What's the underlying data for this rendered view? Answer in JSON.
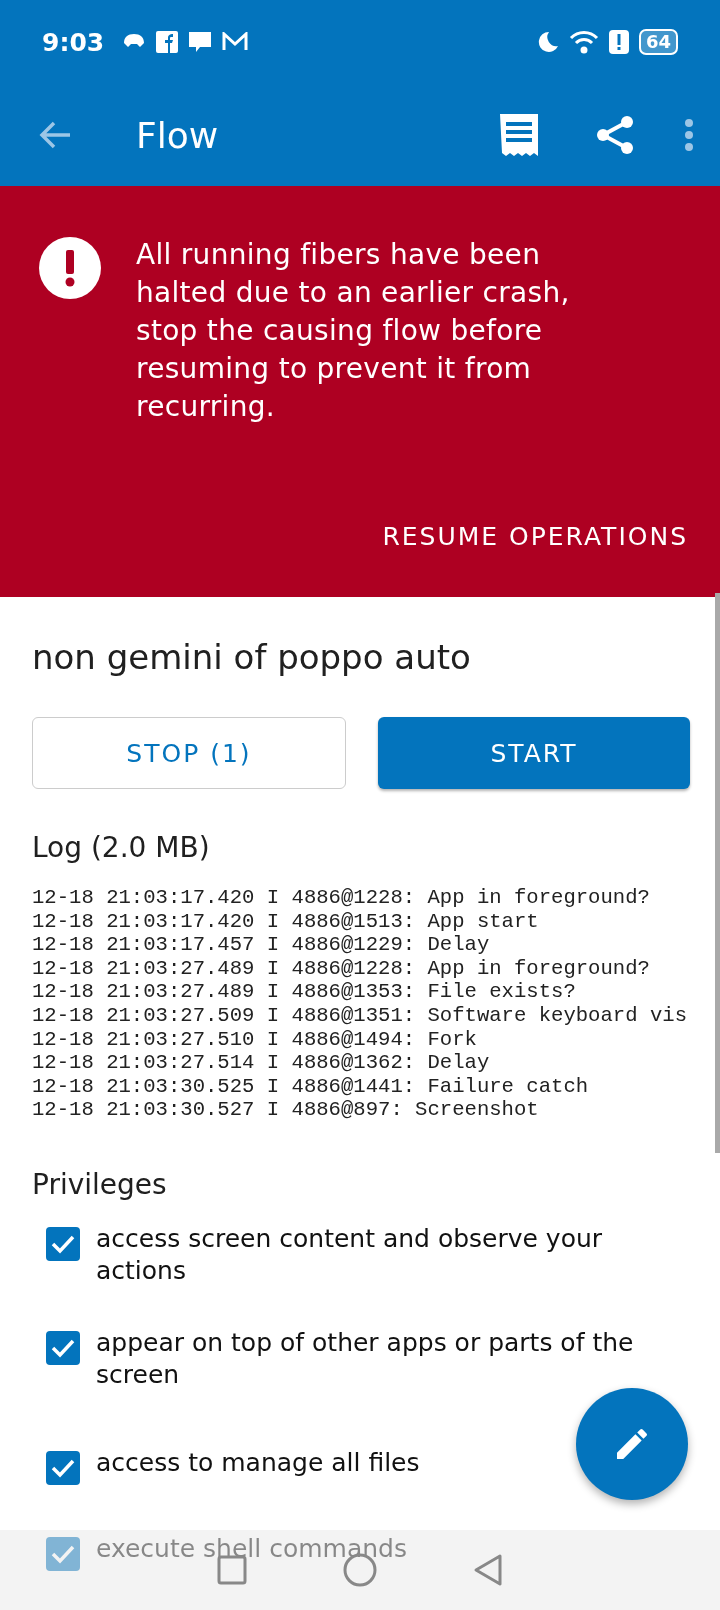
{
  "status_bar": {
    "time": "9:03",
    "battery": "64"
  },
  "app_bar": {
    "title": "Flow"
  },
  "banner": {
    "message": "All running fibers have been halted due to an earlier crash, stop the causing flow before resuming to prevent it from recurring.",
    "action": "RESUME OPERATIONS"
  },
  "flow": {
    "name": "non gemini of poppo auto"
  },
  "buttons": [
    {
      "label": "STOP (1)",
      "kind": "outlined"
    },
    {
      "label": "START",
      "kind": "filled"
    }
  ],
  "log": {
    "title": "Log (2.0 MB)",
    "lines": [
      "12-18 21:03:17.420 I 4886@1228: App in foreground?",
      "12-18 21:03:17.420 I 4886@1513: App start",
      "12-18 21:03:17.457 I 4886@1229: Delay",
      "12-18 21:03:27.489 I 4886@1228: App in foreground?",
      "12-18 21:03:27.489 I 4886@1353: File exists?",
      "12-18 21:03:27.509 I 4886@1351: Software keyboard vis",
      "12-18 21:03:27.510 I 4886@1494: Fork",
      "12-18 21:03:27.514 I 4886@1362: Delay",
      "12-18 21:03:30.525 I 4886@1441: Failure catch",
      "12-18 21:03:30.527 I 4886@897: Screenshot"
    ]
  },
  "privileges": {
    "title": "Privileges",
    "items": [
      {
        "label": "access screen content and observe your actions",
        "checked": true
      },
      {
        "label": "appear on top of other apps or parts of the screen",
        "checked": true
      },
      {
        "label": "access to manage all files",
        "checked": true
      },
      {
        "label": "execute shell commands",
        "checked": true
      }
    ]
  }
}
